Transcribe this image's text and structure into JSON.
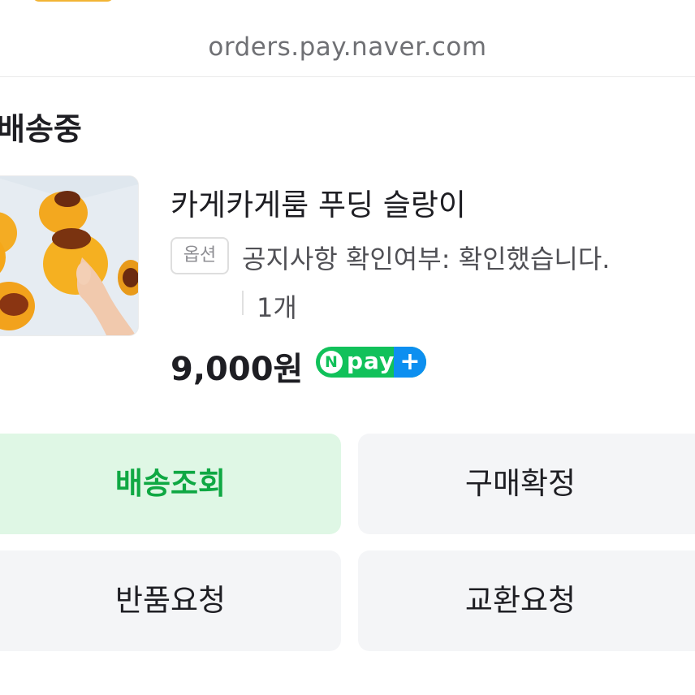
{
  "browser": {
    "url": "orders.pay.naver.com"
  },
  "order": {
    "status": "배송중",
    "product_name": "카게카게룸 푸딩 슬랑이",
    "option_label": "옵션",
    "option_value": "공지사항 확인여부: 확인했습니다.",
    "quantity": "1개",
    "price": "9,000원"
  },
  "npay_badge": {
    "n": "N",
    "text": "pay",
    "plus": "+"
  },
  "actions": {
    "track": "배송조회",
    "confirm": "구매확정",
    "return": "반품요청",
    "exchange": "교환요청"
  },
  "colors": {
    "brand_green": "#11c15a",
    "primary_button_bg": "#dff7e5",
    "primary_button_text": "#0fa843",
    "npay_blue": "#0d8ff0"
  }
}
